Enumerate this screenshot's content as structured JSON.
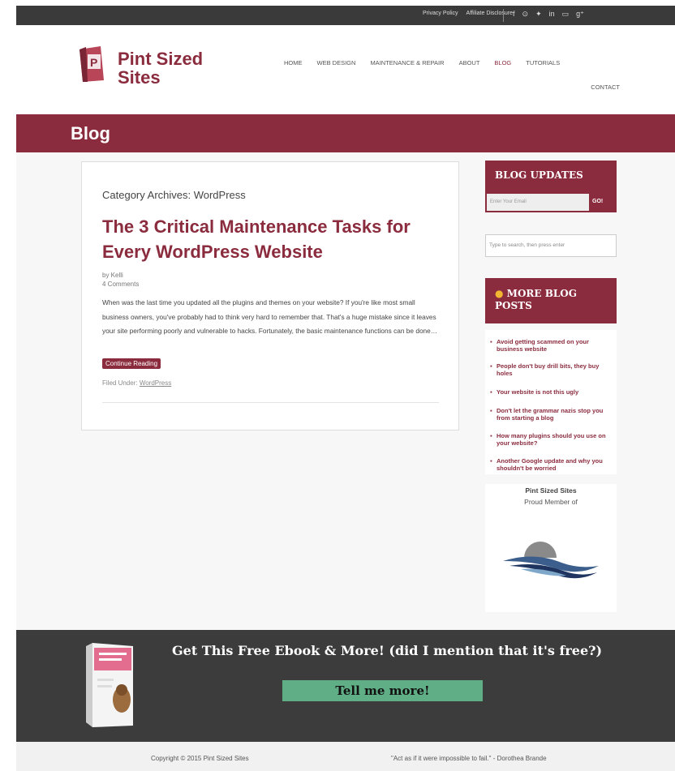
{
  "topbar": {
    "links": [
      "Privacy Policy",
      "Affiliate Disclosure"
    ],
    "social_icons": [
      "facebook-icon",
      "pinterest-icon",
      "twitter-icon",
      "linkedin-icon",
      "youtube-icon",
      "google-plus-icon"
    ],
    "social_glyphs": [
      "f",
      "⊙",
      "✦",
      "in",
      "▭",
      "g⁺"
    ]
  },
  "header": {
    "logo_line1": "Pint Sized",
    "logo_line2": "Sites",
    "nav": [
      "HOME",
      "WEB DESIGN",
      "MAINTENANCE & REPAIR",
      "ABOUT",
      "BLOG",
      "TUTORIALS"
    ],
    "nav_active": "BLOG",
    "nav_second_row": "CONTACT"
  },
  "banner": {
    "title": "Blog"
  },
  "post": {
    "category": "Category Archives: WordPress",
    "title": "The 3 Critical Maintenance Tasks for Every WordPress Website",
    "author": "by Kelli",
    "comments": "4 Comments",
    "excerpt": "When was the last time you updated all the plugins and themes on your website? If you're like most small business owners, you've probably had to think very hard to remember that. That's a huge mistake since it leaves your site performing poorly and vulnerable to hacks. Fortunately, the basic maintenance functions can be done…",
    "continue_label": "Continue Reading",
    "filed_label": "Filed Under:",
    "filed_value": "WordPress"
  },
  "sidebar": {
    "updates_title": "BLOG UPDATES",
    "email_placeholder": "Enter Your Email",
    "go_label": "GO!",
    "search_placeholder": "Type to search, then press enter",
    "more_title": "MORE BLOG POSTS",
    "posts": [
      "Avoid getting scammed on your business website",
      "People don't buy drill bits, they buy holes",
      "Your website is not this ugly",
      "Don't let the grammar nazis stop you from starting a blog",
      "How many plugins should you use on your website?",
      "Another Google update and why you shouldn't be worried"
    ],
    "member_title": "Pint Sized Sites",
    "member_sub": "Proud Member of"
  },
  "cta": {
    "headline": "Get This Free Ebook & More! (did I mention that it's free?)",
    "button": "Tell me more!"
  },
  "footer": {
    "copyright": "Copyright © 2015 Pint Sized Sites",
    "quote": "\"Act as if it were impossible to fail.\" - Dorothea Brande"
  },
  "colors": {
    "brand": "#8b2c3e",
    "dark": "#3a3a3a",
    "cta_button": "#5fae86"
  }
}
